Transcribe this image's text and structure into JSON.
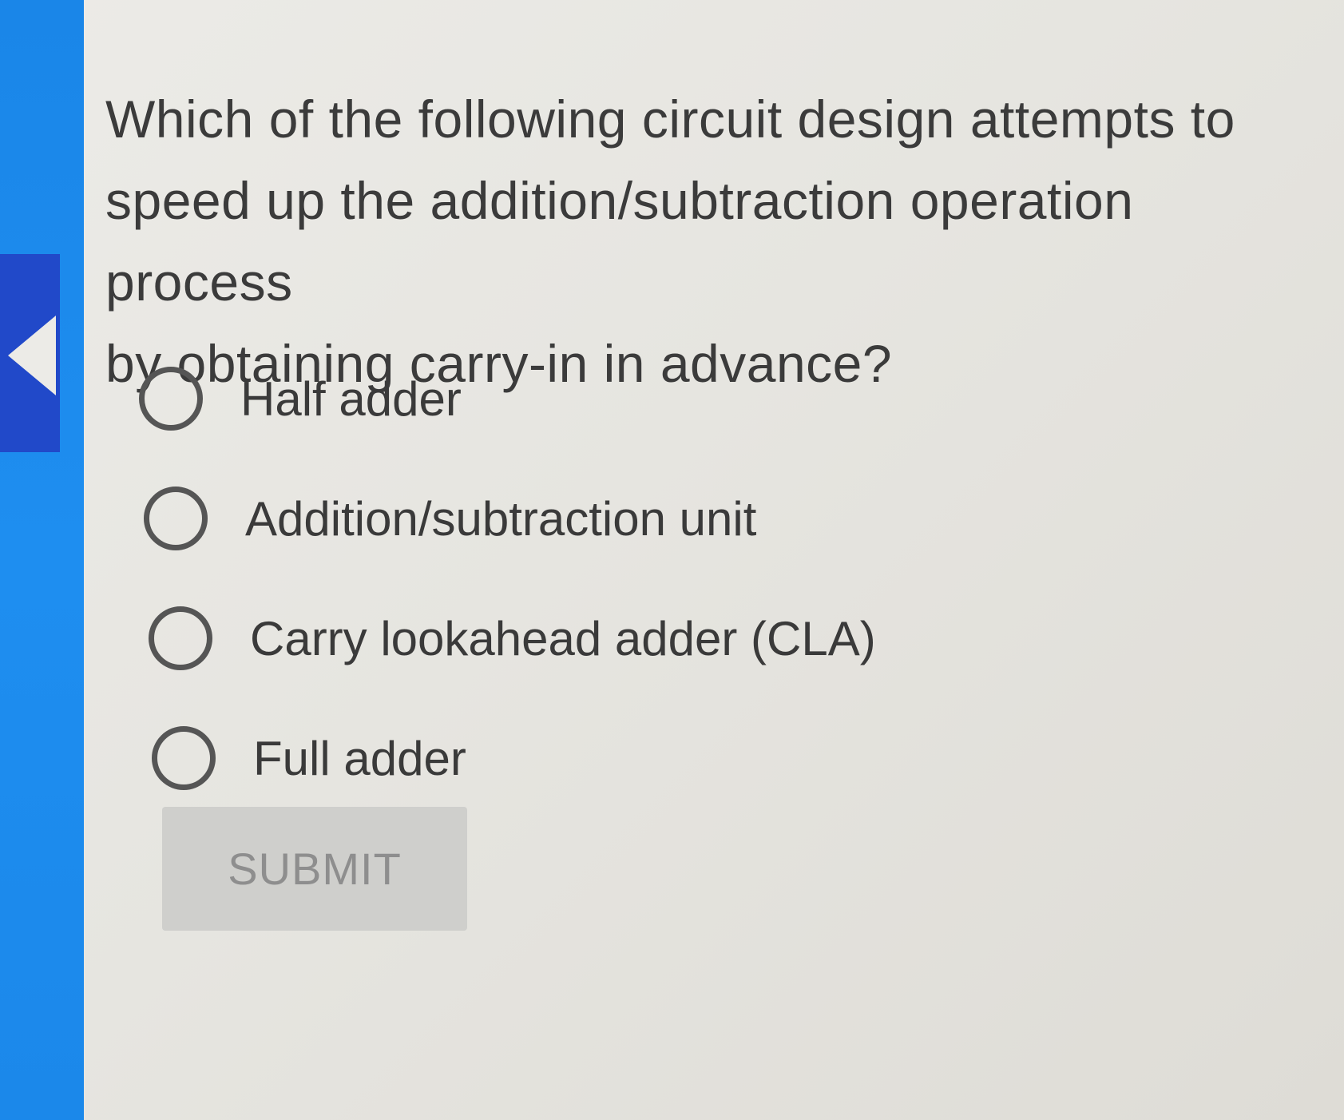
{
  "question": {
    "text": "Which of the following circuit design attempts to\nspeed up the addition/subtraction operation process\nby obtaining carry-in in advance?"
  },
  "options": [
    {
      "label": "Half adder",
      "selected": false
    },
    {
      "label": "Addition/subtraction unit",
      "selected": false
    },
    {
      "label": "Carry lookahead adder (CLA)",
      "selected": false
    },
    {
      "label": "Full adder",
      "selected": false
    }
  ],
  "submit": {
    "label": "SUBMIT",
    "enabled": false
  },
  "colors": {
    "rail": "#1a86e8",
    "rail_active": "#2149c9",
    "background": "#ecebe7",
    "submit_bg": "#cfcfcc"
  }
}
